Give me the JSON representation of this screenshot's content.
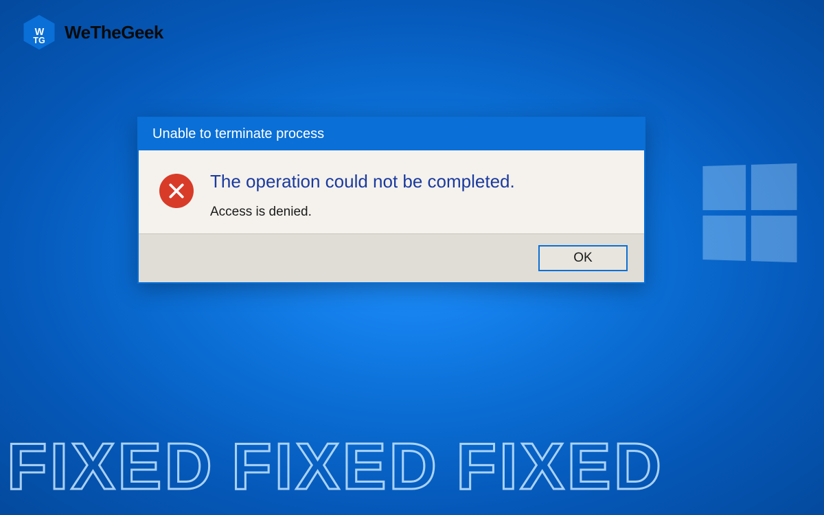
{
  "logo": {
    "brand_text": "WeTheGeek",
    "initials": "WTG"
  },
  "dialog": {
    "title": "Unable to terminate process",
    "main_message": "The operation could not be completed.",
    "sub_message": "Access is denied.",
    "ok_label": "OK",
    "error_icon_name": "error-x-icon"
  },
  "banner": {
    "word1": "FIXED",
    "word2": "FIXED",
    "word3": "FIXED"
  },
  "colors": {
    "titlebar": "#0a6fd6",
    "error_icon": "#d83b28",
    "main_msg": "#1a3a9e"
  }
}
